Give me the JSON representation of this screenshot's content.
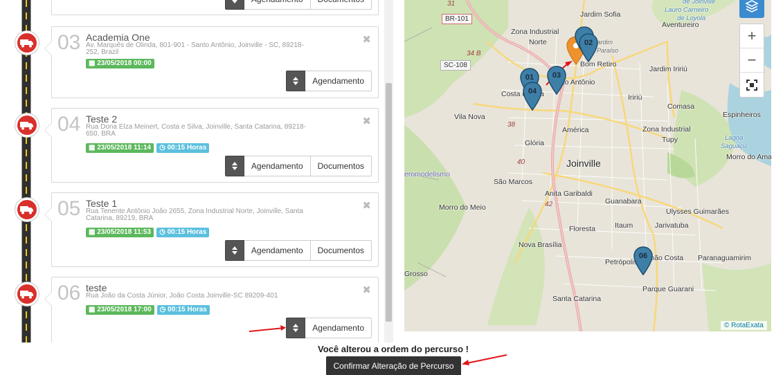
{
  "stops": [
    {
      "number": "",
      "title": "",
      "address": "",
      "buttons": {
        "schedule": "Agendamento",
        "documents": "Documentos"
      }
    },
    {
      "number": "03",
      "title": "Academia One",
      "address": "Av. Marquês de Olinda, 801-901 - Santo Antônio, Joinville - SC, 89218-252, Brazil",
      "date": "23/05/2018 00:00",
      "duration": "",
      "buttons": {
        "schedule": "Agendamento"
      }
    },
    {
      "number": "04",
      "title": "Teste 2",
      "address": "Rua Dona Elza Meinert, Costa e Silva, Joinville, Santa Catarina, 89218-650, BRA",
      "date": "23/05/2018 11:14",
      "duration": "00:15 Horas",
      "buttons": {
        "schedule": "Agendamento",
        "documents": "Documentos"
      }
    },
    {
      "number": "05",
      "title": "Teste 1",
      "address": "Rua Tenente Antônio João 2655, Zona Industrial Norte, Joinville, Santa Catarina, 89219, BRA",
      "date": "23/05/2018 11:53",
      "duration": "00:15 Horas",
      "buttons": {
        "schedule": "Agendamento",
        "documents": "Documentos"
      }
    },
    {
      "number": "06",
      "title": "teste",
      "address": "Rua João da Costa Júnior, João Costa Joinville-SC 89209-401",
      "date": "23/05/2018 17:00",
      "duration": "00:15 Horas",
      "buttons": {
        "schedule": "Agendamento"
      }
    }
  ],
  "map": {
    "places": {
      "jardim_sofia": "Jardim Sofia",
      "zona_industrial_norte_1": "Zona Industrial",
      "zona_industrial_norte_2": "Norte",
      "aventureiro": "Aventureiro",
      "jardim_paraiso_1": "Jardim",
      "jardim_paraiso_2": "Paraíso",
      "bom_retiro": "Bom Retiro",
      "jardim_iririu": "Jardim Iririú",
      "costa_e_silva": "Costa e Silva",
      "santo_antonio": "Santo Antônio",
      "iririu": "Iririú",
      "comasa": "Comasa",
      "espinheiros": "Espinheiros",
      "vila_nova": "Vila Nova",
      "america": "América",
      "zona_industrial_tupy_1": "Zona Industrial",
      "zona_industrial_tupy_2": "Tupy",
      "gloria": "Glória",
      "joinville": "Joinville",
      "morro_do_amaral": "Morro do Ama",
      "aeromodelismo": "eromodelismo",
      "sao_marcos": "São Marcos",
      "anita_garibaldi": "Anita Garibaldi",
      "morro_do_meio": "Morro do Meio",
      "guanabara": "Guanabara",
      "ulysses_guimaraes": "Ulysses Guimarães",
      "floresta": "Floresta",
      "itaum": "Itaum",
      "jarivatuba": "Jarivatuba",
      "nova_brasilia": "Nova Brasília",
      "petropolis": "Petrópolis",
      "joao_costa": "João Costa",
      "paranaguamirim": "Paranaguamirim",
      "grosso": "Grosso",
      "parque_guarani": "Parque Guarani",
      "santa_catarina": "Santa Catarina",
      "vila_de_joinville_1": "de Joinville",
      "vila_de_joinville_2": "Lauro Carneiro",
      "vila_de_joinville_3": "de Loyola",
      "lagoa_1": "Lagoa",
      "lagoa_2": "Saguaçu"
    },
    "shields": {
      "br101": "BR-101",
      "sc108": "SC-108"
    },
    "road_numbers": {
      "r31": "31",
      "r34b": "34 B",
      "r38": "38",
      "r40": "40",
      "r42": "42"
    },
    "pins": [
      "02",
      "01",
      "03",
      "04",
      "06"
    ],
    "zoom_in": "+",
    "zoom_out": "−",
    "attribution": "© RotaExata"
  },
  "notice": "Você alterou a ordem do percurso !",
  "confirm_button": "Confirmar Alteração de Percurso",
  "colors": {
    "truck": "#d9302c",
    "pin": "#3e7fa8",
    "pin_origin": "#f0922b",
    "date_badge": "#5cb85c",
    "time_badge": "#5bc0de",
    "arrow": "#e0151b"
  }
}
